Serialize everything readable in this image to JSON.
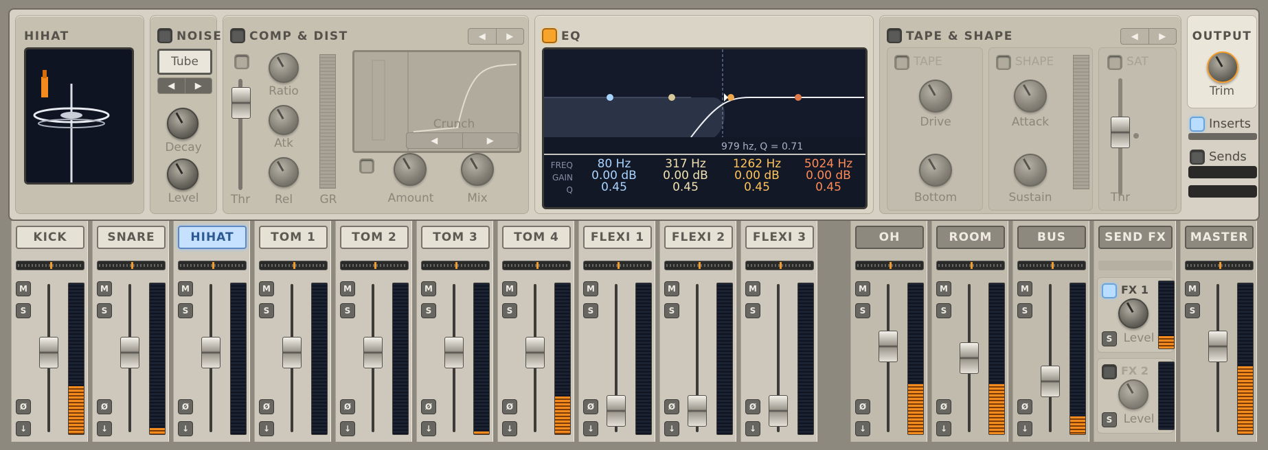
{
  "upper": {
    "instrument": {
      "title": "HIHAT"
    },
    "noise": {
      "title": "NOISE",
      "type": "Tube",
      "decay_label": "Decay",
      "level_label": "Level"
    },
    "comp": {
      "title": "COMP & DIST",
      "ratio": "Ratio",
      "atk": "Atk",
      "thr": "Thr",
      "rel": "Rel",
      "gr": "GR",
      "preset": "Crunch",
      "amount": "Amount",
      "mix": "Mix"
    },
    "eq": {
      "title": "EQ",
      "readout": "979 hz, Q = 0.71",
      "row_labels": [
        "FREQ",
        "GAIN",
        "Q"
      ],
      "bands": [
        {
          "freq": "80 Hz",
          "gain": "0.00 dB",
          "q": "0.45",
          "color": "#a9d3ff"
        },
        {
          "freq": "317 Hz",
          "gain": "0.00 dB",
          "q": "0.45",
          "color": "#f1e2b0"
        },
        {
          "freq": "1262 Hz",
          "gain": "0.00 dB",
          "q": "0.45",
          "color": "#ffc35a"
        },
        {
          "freq": "5024 Hz",
          "gain": "0.00 dB",
          "q": "0.45",
          "color": "#ff8a55"
        }
      ]
    },
    "tape": {
      "title": "TAPE & SHAPE",
      "tape": "TAPE",
      "shape": "SHAPE",
      "sat": "SAT",
      "drive": "Drive",
      "bottom": "Bottom",
      "attack": "Attack",
      "sustain": "Sustain",
      "thr": "Thr"
    },
    "output": {
      "title": "OUTPUT",
      "trim": "Trim",
      "inserts": "Inserts",
      "sends": "Sends"
    }
  },
  "channels": [
    {
      "name": "KICK",
      "pan": 0.5,
      "fader": 0.55,
      "meter": 0.32
    },
    {
      "name": "SNARE",
      "pan": 0.5,
      "fader": 0.55,
      "meter": 0.04
    },
    {
      "name": "HIHAT",
      "pan": 0.5,
      "fader": 0.55,
      "meter": 0.0,
      "selected": true
    },
    {
      "name": "TOM 1",
      "pan": 0.5,
      "fader": 0.55,
      "meter": 0.0
    },
    {
      "name": "TOM 2",
      "pan": 0.5,
      "fader": 0.55,
      "meter": 0.0
    },
    {
      "name": "TOM 3",
      "pan": 0.5,
      "fader": 0.55,
      "meter": 0.02
    },
    {
      "name": "TOM 4",
      "pan": 0.5,
      "fader": 0.55,
      "meter": 0.25
    },
    {
      "name": "FLEXI 1",
      "pan": 0.5,
      "fader": 0.05,
      "meter": 0.0
    },
    {
      "name": "FLEXI 2",
      "pan": 0.5,
      "fader": 0.05,
      "meter": 0.0
    },
    {
      "name": "FLEXI 3",
      "pan": 0.5,
      "fader": 0.05,
      "meter": 0.0
    }
  ],
  "busses": [
    {
      "name": "OH",
      "fader": 0.6,
      "meter": 0.33
    },
    {
      "name": "ROOM",
      "fader": 0.5,
      "meter": 0.33
    },
    {
      "name": "BUS",
      "fader": 0.3,
      "meter": 0.12
    }
  ],
  "sendfx": {
    "name": "SEND FX",
    "fx1": "FX 1",
    "fx2": "FX 2",
    "level": "Level"
  },
  "master": {
    "name": "MASTER",
    "fader": 0.6,
    "meter": 0.45
  },
  "buttons": {
    "m": "M",
    "s": "S",
    "phase": "Ø",
    "arrow": "↓"
  },
  "colors": {
    "accent": "#f39c29",
    "select": "#8ec8ff"
  }
}
